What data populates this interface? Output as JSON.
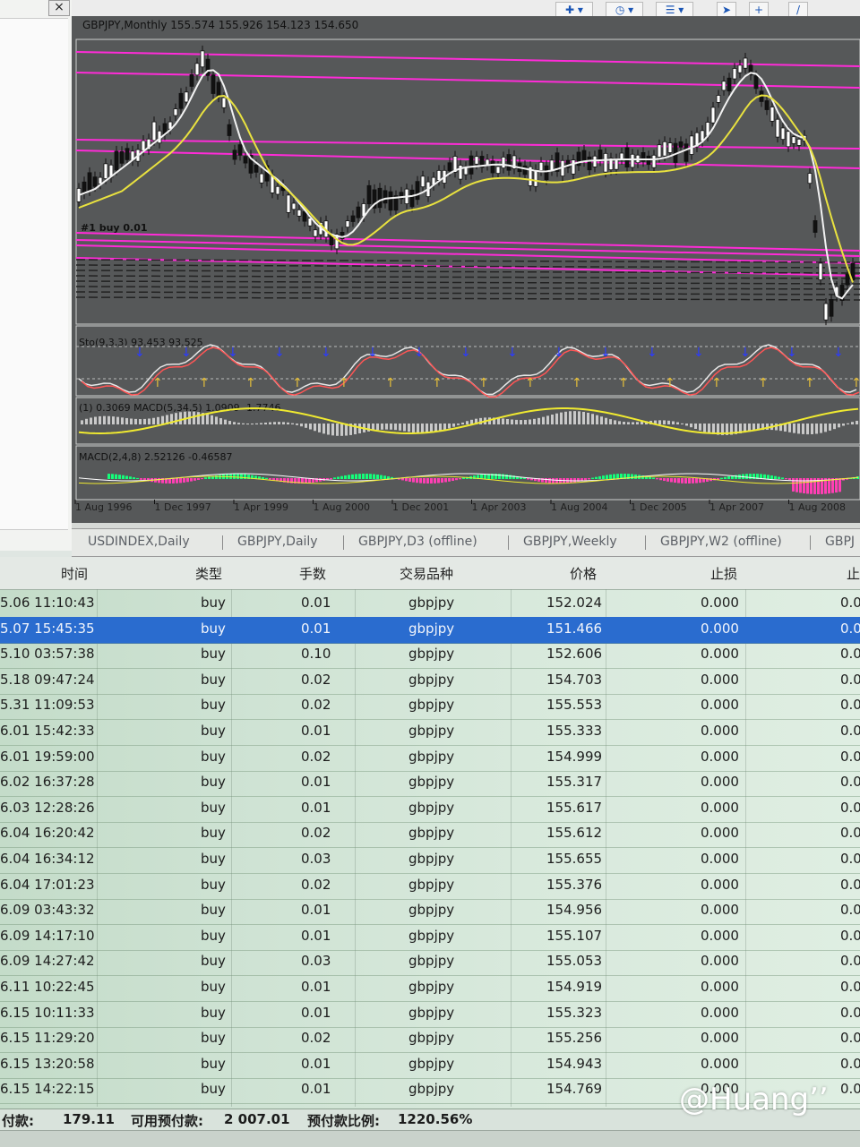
{
  "window": {
    "close_glyph": "×",
    "chart_title": "GBPJPY,Monthly",
    "ohlc": {
      "open": "155.574",
      "high": "155.926",
      "low": "154.123",
      "close": "154.650"
    }
  },
  "toolbar": {
    "icons": [
      "new-chart-icon",
      "history-icon",
      "template-icon",
      "cursor-icon",
      "crosshair-icon",
      "periodicity-icon"
    ]
  },
  "chart_data": {
    "type": "candlestick",
    "symbol": "GBPJPY",
    "timeframe": "Monthly",
    "x_tick_labels": [
      "1 Aug 1996",
      "1 Dec 1997",
      "1 Apr 1999",
      "1 Aug 2000",
      "1 Dec 2001",
      "1 Apr 2003",
      "1 Aug 2004",
      "1 Dec 2005",
      "1 Apr 2007",
      "1 Aug 2008"
    ],
    "order_label": "buy 0.01",
    "indicators": {
      "stochastic": {
        "label": "Sto(9,3,3) 93.453 93.525"
      },
      "macd": {
        "label": "MACD(5,34,5) 1.0909 -1.7746",
        "prefix": "(1) 0.3069"
      },
      "macd2": {
        "label": "MACD(2,4,8) 2.52126 -0.46587"
      }
    },
    "colors": {
      "background": "#565859",
      "candle": "#111111",
      "fast_ma": "#f2f2f2",
      "slow_ma": "#e9e23f",
      "level_lines": "#ff2bd8",
      "stoch_main": "#e7e7e7",
      "stoch_signal": "#ff5555",
      "macd_line": "#f0ea30",
      "hist_pos": "#14ff7a",
      "hist_neg": "#ff3fb4"
    },
    "grid": false
  },
  "tabs": [
    "USDINDEX,Daily",
    "GBPJPY,Daily",
    "GBPJPY,D3 (offline)",
    "GBPJPY,Weekly",
    "GBPJPY,W2 (offline)",
    "GBPJ"
  ],
  "table": {
    "headers": {
      "time": "时间",
      "type": "类型",
      "lots": "手数",
      "symbol": "交易品种",
      "price": "价格",
      "sl": "止损",
      "tp": "止"
    },
    "rows": [
      {
        "time": "5.06 11:10:43",
        "type": "buy",
        "lots": "0.01",
        "symbol": "gbpjpy",
        "price": "152.024",
        "sl": "0.000",
        "tp": "0.0"
      },
      {
        "time": "5.07 15:45:35",
        "type": "buy",
        "lots": "0.01",
        "symbol": "gbpjpy",
        "price": "151.466",
        "sl": "0.000",
        "tp": "0.0"
      },
      {
        "time": "5.10 03:57:38",
        "type": "buy",
        "lots": "0.10",
        "symbol": "gbpjpy",
        "price": "152.606",
        "sl": "0.000",
        "tp": "0.0"
      },
      {
        "time": "5.18 09:47:24",
        "type": "buy",
        "lots": "0.02",
        "symbol": "gbpjpy",
        "price": "154.703",
        "sl": "0.000",
        "tp": "0.0"
      },
      {
        "time": "5.31 11:09:53",
        "type": "buy",
        "lots": "0.02",
        "symbol": "gbpjpy",
        "price": "155.553",
        "sl": "0.000",
        "tp": "0.0"
      },
      {
        "time": "6.01 15:42:33",
        "type": "buy",
        "lots": "0.01",
        "symbol": "gbpjpy",
        "price": "155.333",
        "sl": "0.000",
        "tp": "0.0"
      },
      {
        "time": "6.01 19:59:00",
        "type": "buy",
        "lots": "0.02",
        "symbol": "gbpjpy",
        "price": "154.999",
        "sl": "0.000",
        "tp": "0.0"
      },
      {
        "time": "6.02 16:37:28",
        "type": "buy",
        "lots": "0.01",
        "symbol": "gbpjpy",
        "price": "155.317",
        "sl": "0.000",
        "tp": "0.0"
      },
      {
        "time": "6.03 12:28:26",
        "type": "buy",
        "lots": "0.01",
        "symbol": "gbpjpy",
        "price": "155.617",
        "sl": "0.000",
        "tp": "0.0"
      },
      {
        "time": "6.04 16:20:42",
        "type": "buy",
        "lots": "0.02",
        "symbol": "gbpjpy",
        "price": "155.612",
        "sl": "0.000",
        "tp": "0.0"
      },
      {
        "time": "6.04 16:34:12",
        "type": "buy",
        "lots": "0.03",
        "symbol": "gbpjpy",
        "price": "155.655",
        "sl": "0.000",
        "tp": "0.0"
      },
      {
        "time": "6.04 17:01:23",
        "type": "buy",
        "lots": "0.02",
        "symbol": "gbpjpy",
        "price": "155.376",
        "sl": "0.000",
        "tp": "0.0"
      },
      {
        "time": "6.09 03:43:32",
        "type": "buy",
        "lots": "0.01",
        "symbol": "gbpjpy",
        "price": "154.956",
        "sl": "0.000",
        "tp": "0.0"
      },
      {
        "time": "6.09 14:17:10",
        "type": "buy",
        "lots": "0.01",
        "symbol": "gbpjpy",
        "price": "155.107",
        "sl": "0.000",
        "tp": "0.0"
      },
      {
        "time": "6.09 14:27:42",
        "type": "buy",
        "lots": "0.03",
        "symbol": "gbpjpy",
        "price": "155.053",
        "sl": "0.000",
        "tp": "0.0"
      },
      {
        "time": "6.11 10:22:45",
        "type": "buy",
        "lots": "0.01",
        "symbol": "gbpjpy",
        "price": "154.919",
        "sl": "0.000",
        "tp": "0.0"
      },
      {
        "time": "6.15 10:11:33",
        "type": "buy",
        "lots": "0.01",
        "symbol": "gbpjpy",
        "price": "155.323",
        "sl": "0.000",
        "tp": "0.0"
      },
      {
        "time": "6.15 11:29:20",
        "type": "buy",
        "lots": "0.02",
        "symbol": "gbpjpy",
        "price": "155.256",
        "sl": "0.000",
        "tp": "0.0"
      },
      {
        "time": "6.15 13:20:58",
        "type": "buy",
        "lots": "0.01",
        "symbol": "gbpjpy",
        "price": "154.943",
        "sl": "0.000",
        "tp": "0.0"
      },
      {
        "time": "6.15 14:22:15",
        "type": "buy",
        "lots": "0.01",
        "symbol": "gbpjpy",
        "price": "154.769",
        "sl": "0.000",
        "tp": "0.0"
      }
    ],
    "selected_index": 1
  },
  "status": {
    "margin_label": "付款:",
    "margin_value": "179.11",
    "free_label": "可用预付款:",
    "free_value": "2 007.01",
    "level_label": "预付款比例:",
    "level_value": "1220.56%"
  },
  "watermark": "@Huang’’"
}
